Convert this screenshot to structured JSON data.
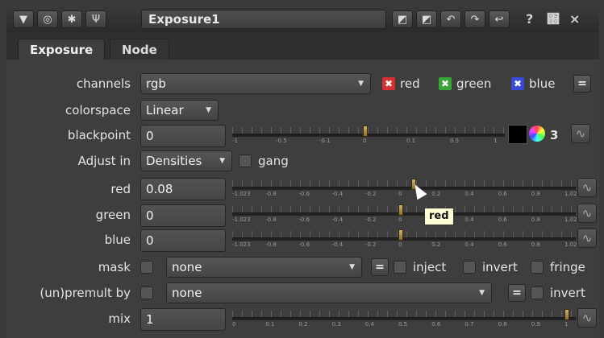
{
  "title_bar": {
    "node_name": "Exposure1",
    "icons": [
      "menu-triangle-icon",
      "target-icon",
      "ladybug-icon",
      "wrench-icon",
      "undo-icon",
      "redo-icon",
      "revert-icon",
      "help-icon",
      "float-icon",
      "close-icon"
    ],
    "help_label": "?",
    "float_label": "΀",
    "close_label": "×"
  },
  "tabs": [
    {
      "label": "Exposure",
      "active": true
    },
    {
      "label": "Node",
      "active": false
    }
  ],
  "channels": {
    "label": "channels",
    "value": "rgb",
    "items": [
      {
        "label": "red",
        "color": "#d63030"
      },
      {
        "label": "green",
        "color": "#37a637"
      },
      {
        "label": "blue",
        "color": "#3b48d6"
      }
    ],
    "eq_label": "="
  },
  "colorspace": {
    "label": "colorspace",
    "value": "Linear"
  },
  "blackpoint": {
    "label": "blackpoint",
    "value": "0",
    "slider_ticks": [
      "-1",
      "-0.5",
      "-0.1",
      "0",
      "0.1",
      "0.5",
      "1"
    ],
    "slider_value": 0,
    "channel_count": "3"
  },
  "adjust_in": {
    "label": "Adjust in",
    "value": "Densities",
    "gang_label": "gang"
  },
  "red": {
    "label": "red",
    "value": "0.08",
    "slider_value": 0.08
  },
  "green": {
    "label": "green",
    "value": "0",
    "slider_value": 0
  },
  "blue": {
    "label": "blue",
    "value": "0",
    "slider_value": 0
  },
  "density_ticks": [
    "-1.023",
    "-0.8",
    "-0.6",
    "-0.4",
    "-0.2",
    "0",
    "0.2",
    "0.4",
    "0.6",
    "0.8",
    "1.023"
  ],
  "tooltip": "red",
  "mask": {
    "label": "mask",
    "value": "none",
    "eq_label": "=",
    "inject_label": "inject",
    "invert_label": "invert",
    "fringe_label": "fringe"
  },
  "unpremult": {
    "label": "(un)premult by",
    "value": "none",
    "eq_label": "=",
    "invert_label": "invert"
  },
  "mix": {
    "label": "mix",
    "value": "1",
    "slider_value": 1,
    "slider_ticks": [
      "0",
      "0.1",
      "0.2",
      "0.3",
      "0.4",
      "0.5",
      "0.6",
      "0.7",
      "0.8",
      "0.9",
      "1"
    ]
  },
  "colors": {
    "panel": "#3e3e3e",
    "handle": "#c8a85a",
    "tooltip_bg": "#ffffd6"
  }
}
